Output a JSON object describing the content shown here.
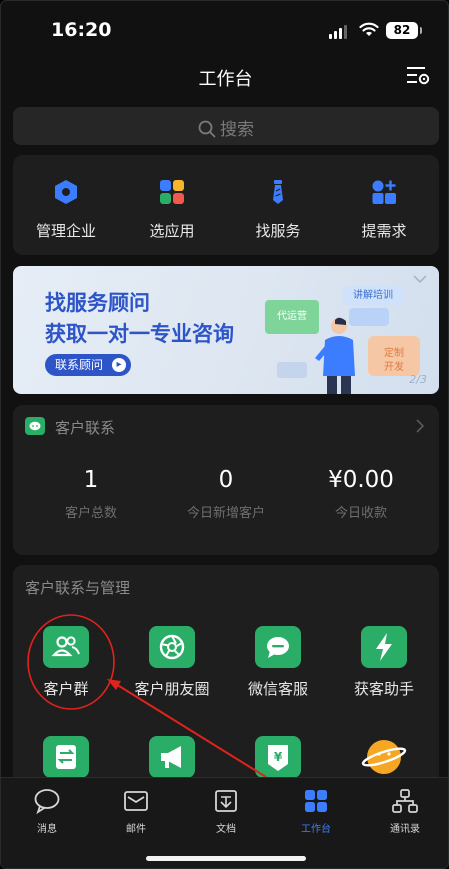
{
  "status_bar": {
    "time": "16:20",
    "battery": "82"
  },
  "header": {
    "title": "工作台"
  },
  "search": {
    "placeholder": "搜索"
  },
  "tools": [
    {
      "label": "管理企业",
      "icon": "hexagon-icon"
    },
    {
      "label": "选应用",
      "icon": "apps-grid-icon"
    },
    {
      "label": "找服务",
      "icon": "tie-icon"
    },
    {
      "label": "提需求",
      "icon": "shapes-icon"
    }
  ],
  "banner": {
    "title_line1": "找服务顾问",
    "title_line2": "获取一对一专业咨询",
    "cta": "联系顾问",
    "tag_ops": "代运营",
    "tag_training": "讲解培训",
    "tag_custom_1": "定制",
    "tag_custom_2": "开发",
    "page": "2/3"
  },
  "contact": {
    "title": "客户联系",
    "stats": [
      {
        "value": "1",
        "label": "客户总数"
      },
      {
        "value": "0",
        "label": "今日新增客户"
      },
      {
        "value": "¥0.00",
        "label": "今日收款"
      }
    ]
  },
  "management": {
    "title": "客户联系与管理",
    "apps": [
      {
        "label": "客户群",
        "icon": "customer-group-icon"
      },
      {
        "label": "客户朋友圈",
        "icon": "moments-aperture-icon"
      },
      {
        "label": "微信客服",
        "icon": "chat-bubble-icon"
      },
      {
        "label": "获客助手",
        "icon": "lightning-icon"
      },
      {
        "label": "",
        "icon": "transfer-icon"
      },
      {
        "label": "",
        "icon": "megaphone-icon"
      },
      {
        "label": "",
        "icon": "yuan-payment-icon"
      },
      {
        "label": "",
        "icon": "planet-icon"
      }
    ]
  },
  "tabbar": [
    {
      "label": "消息",
      "icon": "message-bubble-icon"
    },
    {
      "label": "邮件",
      "icon": "mail-icon"
    },
    {
      "label": "文档",
      "icon": "document-icon"
    },
    {
      "label": "工作台",
      "icon": "workbench-grid-icon",
      "active": true
    },
    {
      "label": "通讯录",
      "icon": "contacts-icon"
    }
  ],
  "colors": {
    "background": "#111111",
    "card": "#1e1e1e",
    "brand_blue": "#2d55c8",
    "accent_blue": "#3c7dff",
    "app_green": "#2aae67",
    "annotation_red": "#e0231c"
  }
}
